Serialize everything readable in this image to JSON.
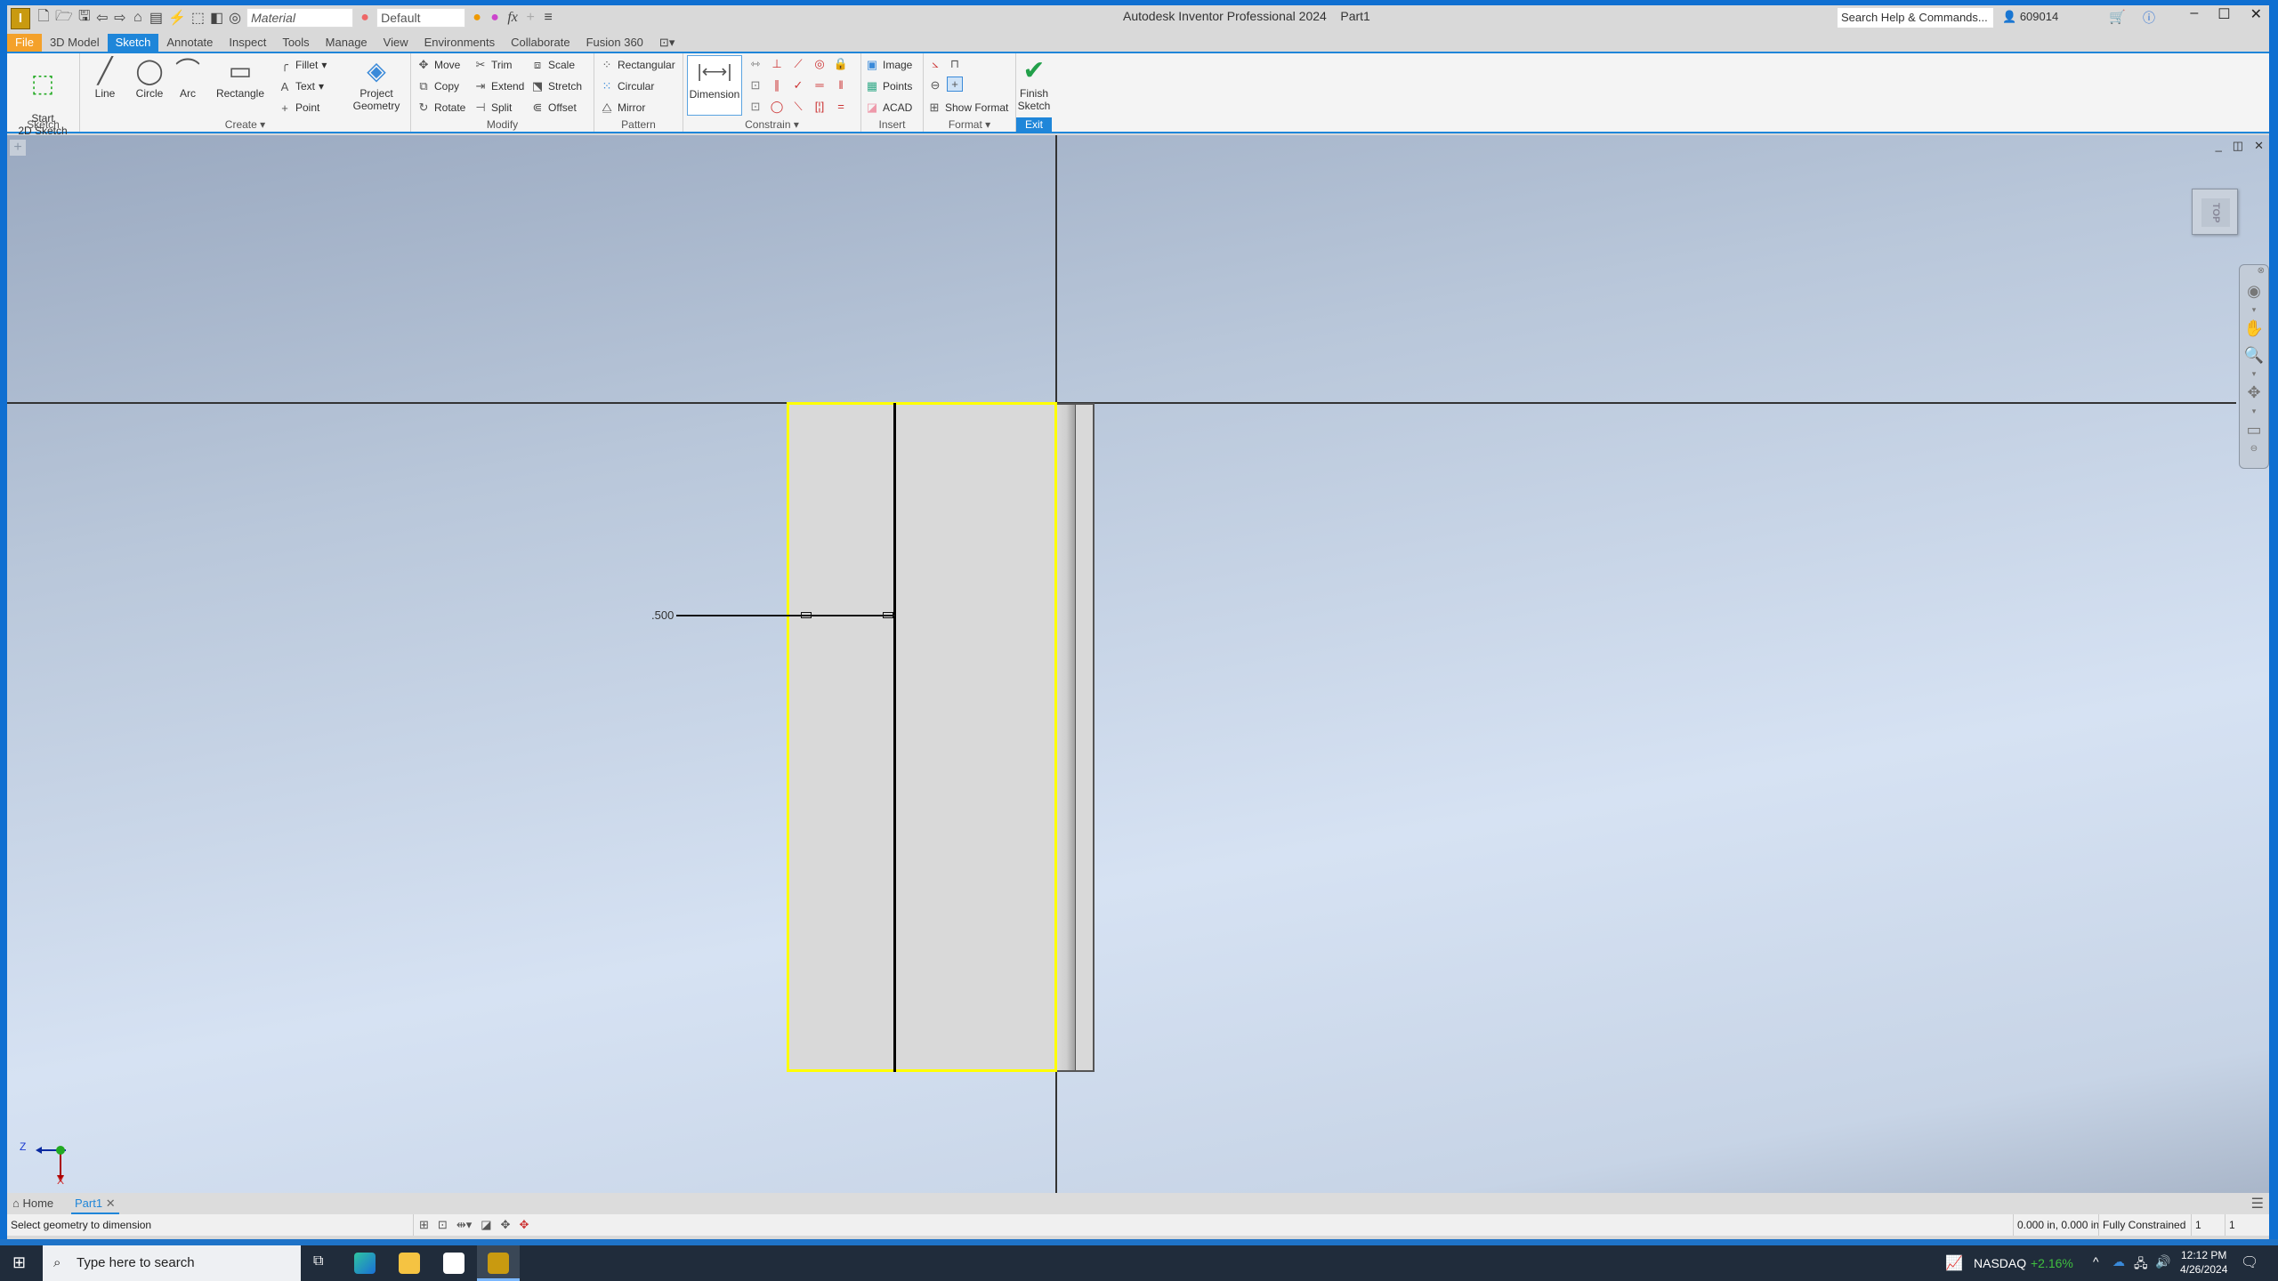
{
  "window": {
    "title": "Autodesk Inventor Professional 2024",
    "doc": "Part1",
    "app_letter": "I"
  },
  "quick_access": {
    "material_placeholder": "Material",
    "appearance": "Default",
    "fx": "fx"
  },
  "help": {
    "search_placeholder": "Search Help & Commands...",
    "user": "609014"
  },
  "tabs": [
    "File",
    "3D Model",
    "Sketch",
    "Annotate",
    "Inspect",
    "Tools",
    "Manage",
    "View",
    "Environments",
    "Collaborate",
    "Fusion 360"
  ],
  "ribbon": {
    "sketch": {
      "label": "Sketch",
      "start": "Start\n2D Sketch"
    },
    "create": {
      "label": "Create",
      "line": "Line",
      "circle": "Circle",
      "arc": "Arc",
      "rectangle": "Rectangle",
      "fillet": "Fillet",
      "text": "Text",
      "point": "Point",
      "project": "Project\nGeometry"
    },
    "modify": {
      "label": "Modify",
      "move": "Move",
      "copy": "Copy",
      "rotate": "Rotate",
      "trim": "Trim",
      "extend": "Extend",
      "split": "Split",
      "scale": "Scale",
      "stretch": "Stretch",
      "offset": "Offset"
    },
    "pattern": {
      "label": "Pattern",
      "rectangular": "Rectangular",
      "circular": "Circular",
      "mirror": "Mirror"
    },
    "constrain": {
      "label": "Constrain",
      "dimension": "Dimension"
    },
    "insert": {
      "label": "Insert",
      "image": "Image",
      "points": "Points",
      "acad": "ACAD"
    },
    "format": {
      "label": "Format",
      "show_format": "Show Format"
    },
    "exit": {
      "label": "Exit",
      "finish": "Finish\nSketch"
    }
  },
  "viewport": {
    "viewcube_face": "TOP",
    "dimension_value": ".500",
    "triad": {
      "z": "Z",
      "x": "X"
    }
  },
  "doc_tabs": {
    "home": "Home",
    "part": "Part1"
  },
  "status": {
    "prompt": "Select geometry to dimension",
    "coords": "0.000 in, 0.000 in",
    "constraint": "Fully Constrained",
    "count1": "1",
    "count2": "1"
  },
  "taskbar": {
    "search_placeholder": "Type here to search",
    "ticker": "NASDAQ",
    "ticker_change": "+2.16%",
    "time": "12:12 PM",
    "date": "4/26/2024"
  }
}
